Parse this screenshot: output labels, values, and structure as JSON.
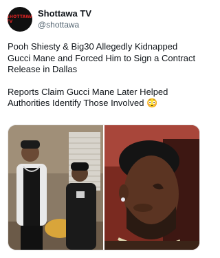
{
  "account": {
    "display_name": "Shottawa TV",
    "handle": "@shottawa",
    "avatar_text": "SHOTTAWA TV"
  },
  "tweet": {
    "paragraph1": "Pooh Shiesty & Big30 Allegedly Kidnapped Gucci Mane and Forced Him to Sign a Contract Release in Dallas",
    "paragraph2": "Reports Claim Gucci Mane Later Helped Authorities Identify Those Involved 😳"
  },
  "media": {
    "left_photo": "two-men-in-studio",
    "right_photo": "man-portrait-with-face-tattoo"
  }
}
